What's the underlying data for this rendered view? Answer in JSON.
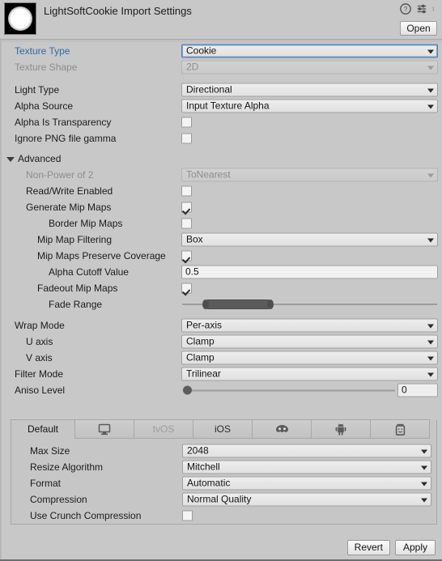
{
  "header": {
    "title": "LightSoftCookie Import Settings",
    "thumbnail_icon": "light-cookie-texture-thumbnail",
    "help_icon": "help-icon",
    "preset_icon": "preset-settings-icon",
    "menu_icon": "kebab-menu-icon",
    "open_label": "Open"
  },
  "main": {
    "texture_type": {
      "label": "Texture Type",
      "value": "Cookie",
      "state": "focused",
      "label_color": "#2f6ca8"
    },
    "texture_shape": {
      "label": "Texture Shape",
      "value": "2D",
      "state": "disabled"
    },
    "light_type": {
      "label": "Light Type",
      "value": "Directional"
    },
    "alpha_source": {
      "label": "Alpha Source",
      "value": "Input Texture Alpha"
    },
    "alpha_is_transparency": {
      "label": "Alpha Is Transparency",
      "checked": false
    },
    "ignore_png_gamma": {
      "label": "Ignore PNG file gamma",
      "checked": false
    }
  },
  "advanced": {
    "label": "Advanced",
    "expanded": true,
    "non_power_of_2": {
      "label": "Non-Power of 2",
      "value": "ToNearest",
      "state": "disabled"
    },
    "read_write_enabled": {
      "label": "Read/Write Enabled",
      "checked": false
    },
    "generate_mip_maps": {
      "label": "Generate Mip Maps",
      "checked": true
    },
    "border_mip_maps": {
      "label": "Border Mip Maps",
      "checked": false
    },
    "mip_map_filtering": {
      "label": "Mip Map Filtering",
      "value": "Box"
    },
    "mip_maps_preserve_coverage": {
      "label": "Mip Maps Preserve Coverage",
      "checked": true
    },
    "alpha_cutoff_value": {
      "label": "Alpha Cutoff Value",
      "value": "0.5"
    },
    "fadeout_mip_maps": {
      "label": "Fadeout Mip Maps",
      "checked": true
    },
    "fade_range": {
      "label": "Fade Range",
      "min_pct": 10,
      "max_pct": 34
    }
  },
  "sampling": {
    "wrap_mode": {
      "label": "Wrap Mode",
      "value": "Per-axis"
    },
    "u_axis": {
      "label": "U axis",
      "value": "Clamp"
    },
    "v_axis": {
      "label": "V axis",
      "value": "Clamp"
    },
    "filter_mode": {
      "label": "Filter Mode",
      "value": "Trilinear"
    },
    "aniso_level": {
      "label": "Aniso Level",
      "value": "0",
      "handle_pct": 0
    }
  },
  "platform_tabs": [
    {
      "label": "Default",
      "icon": "",
      "active": true,
      "dim": false
    },
    {
      "label": "",
      "icon": "monitor-icon",
      "active": false,
      "dim": false
    },
    {
      "label": "tvOS",
      "icon": "",
      "active": false,
      "dim": true
    },
    {
      "label": "iOS",
      "icon": "",
      "active": false,
      "dim": false
    },
    {
      "label": "",
      "icon": "webgl-icon",
      "active": false,
      "dim": false
    },
    {
      "label": "",
      "icon": "android-icon",
      "active": false,
      "dim": false
    },
    {
      "label": "",
      "icon": "uwp-icon",
      "active": false,
      "dim": false
    }
  ],
  "platform_settings": {
    "max_size": {
      "label": "Max Size",
      "value": "2048"
    },
    "resize_algorithm": {
      "label": "Resize Algorithm",
      "value": "Mitchell"
    },
    "format": {
      "label": "Format",
      "value": "Automatic"
    },
    "compression": {
      "label": "Compression",
      "value": "Normal Quality"
    },
    "use_crunch_compression": {
      "label": "Use Crunch Compression",
      "checked": false
    }
  },
  "footer": {
    "revert_label": "Revert",
    "apply_label": "Apply"
  }
}
